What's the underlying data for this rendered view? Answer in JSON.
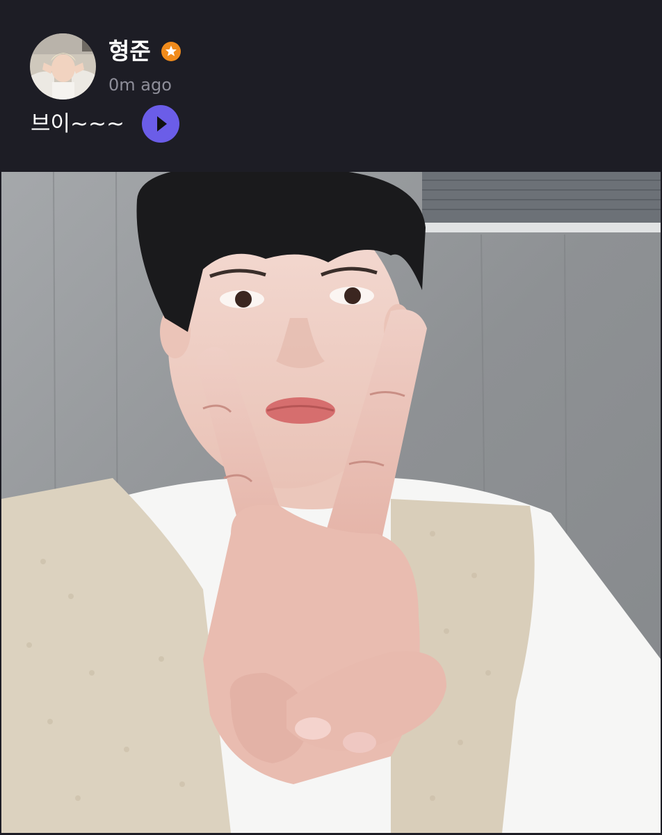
{
  "post": {
    "author": {
      "name": "형준",
      "avatar_icon": "avatar-photo",
      "badge_icon": "star-badge-icon",
      "badge_color": "#f08b1c"
    },
    "timestamp": "0m ago",
    "caption": "브이~~~",
    "play_icon": "play-icon",
    "play_color": "#6b5de8",
    "photo_subject": "selfie-v-sign"
  },
  "colors": {
    "background": "#1d1d25",
    "text_primary": "#ffffff",
    "text_secondary": "#8e8e99"
  }
}
